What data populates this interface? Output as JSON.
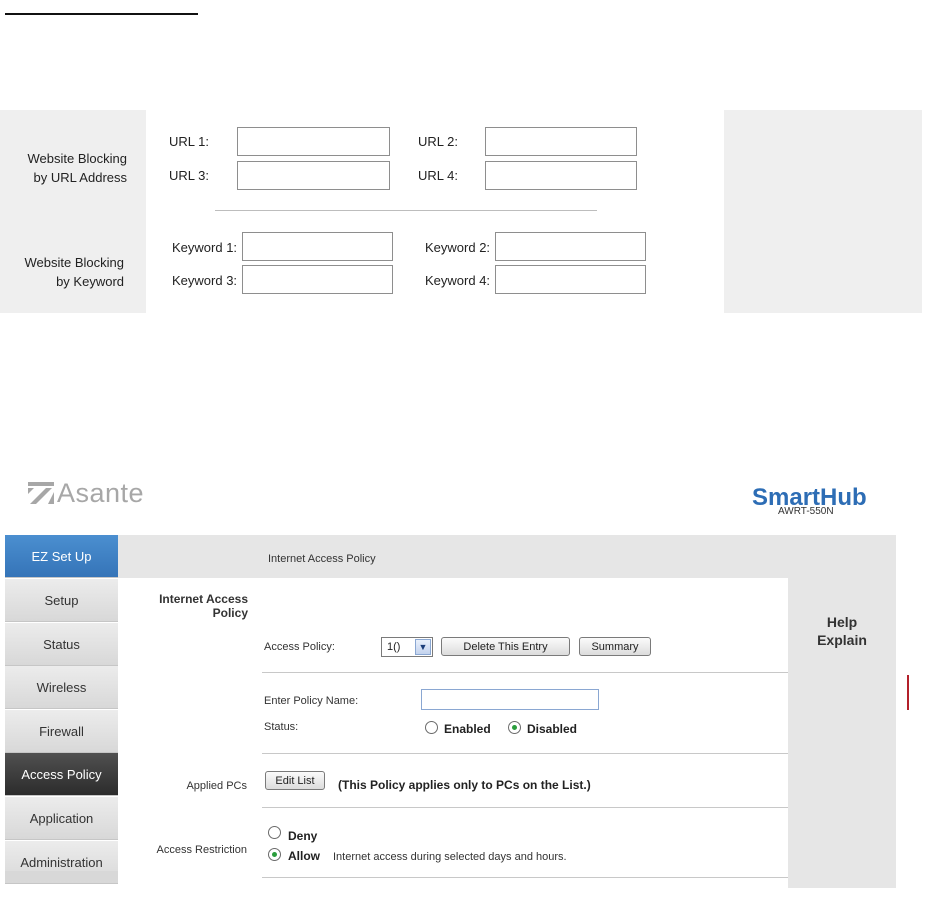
{
  "website_blocking": {
    "url_section_label": [
      "Website Blocking",
      "by URL Address"
    ],
    "keyword_section_label": [
      "Website Blocking",
      "by Keyword"
    ],
    "url_labels": [
      "URL 1:",
      "URL 2:",
      "URL 3:",
      "URL 4:"
    ],
    "keyword_labels": [
      "Keyword 1:",
      "Keyword 2:",
      "Keyword 3:",
      "Keyword 4:"
    ]
  },
  "router": {
    "brand": "Asante",
    "product": "SmartHub",
    "model": "AWRT-550N",
    "nav": [
      "EZ Set Up",
      "Setup",
      "Status",
      "Wireless",
      "Firewall",
      "Access Policy",
      "Application",
      "Administration"
    ],
    "active_nav": "Access Policy",
    "page_title": "Internet Access Policy",
    "help": [
      "Help",
      "Explain"
    ],
    "section_internet_access": [
      "Internet Access",
      "Policy"
    ],
    "access_policy_label": "Access Policy:",
    "access_policy_value": "1()",
    "delete_button": "Delete This Entry",
    "summary_button": "Summary",
    "policy_name_label": "Enter Policy Name:",
    "policy_name_value": "",
    "status_label": "Status:",
    "status_enabled": "Enabled",
    "status_disabled": "Disabled",
    "status_selected": "Disabled",
    "applied_pcs_label": "Applied PCs",
    "edit_list_button": "Edit List",
    "applied_note": "(This Policy applies only to PCs on the List.)",
    "access_restriction_label": "Access Restriction",
    "deny_label": "Deny",
    "allow_label": "Allow",
    "allow_note": "Internet access during selected days and hours.",
    "restriction_selected": "Allow",
    "colors": {
      "accent_blue": "#3574b8",
      "active_dark": "#2c2c2c",
      "brand_blue": "#2d6db5",
      "radio_green": "#2a9d3c"
    }
  }
}
